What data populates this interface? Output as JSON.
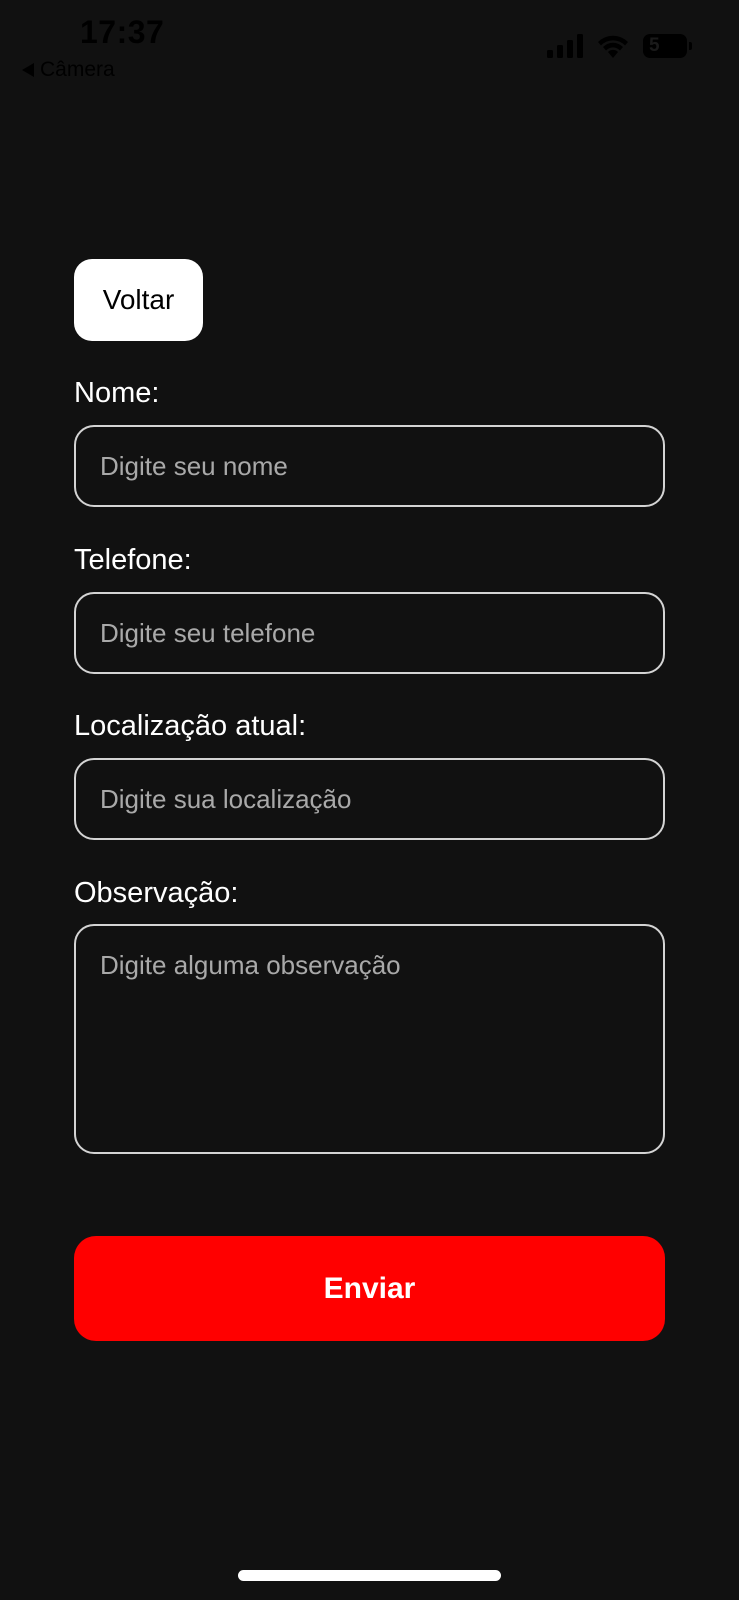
{
  "status_bar": {
    "time": "17:37",
    "back_app_label": "Câmera",
    "battery_level": "5"
  },
  "form": {
    "back_button_label": "Voltar",
    "name": {
      "label": "Nome:",
      "placeholder": "Digite seu nome",
      "value": ""
    },
    "phone": {
      "label": "Telefone:",
      "placeholder": "Digite seu telefone",
      "value": ""
    },
    "location": {
      "label": "Localização atual:",
      "placeholder": "Digite sua localização",
      "value": ""
    },
    "observation": {
      "label": "Observação:",
      "placeholder": "Digite alguma observação",
      "value": ""
    },
    "submit_label": "Enviar"
  },
  "colors": {
    "background": "#111111",
    "accent": "#ff0000",
    "input_border": "#d4d4d4",
    "placeholder": "#a9a9a9"
  },
  "icons": {
    "back_app": "back-triangle-icon",
    "signal": "cellular-signal-icon",
    "wifi": "wifi-icon",
    "battery": "battery-icon"
  }
}
